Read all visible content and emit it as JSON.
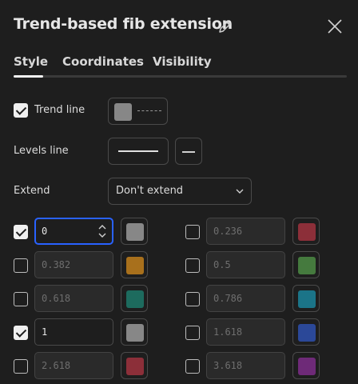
{
  "dialog": {
    "title": "Trend-based fib extension"
  },
  "tabs": [
    {
      "label": "Style",
      "active": true
    },
    {
      "label": "Coordinates",
      "active": false
    },
    {
      "label": "Visibility",
      "active": false
    }
  ],
  "style": {
    "trend_line": {
      "label": "Trend line",
      "checked": true,
      "color": "#878787"
    },
    "levels_line": {
      "label": "Levels line"
    },
    "extend": {
      "label": "Extend",
      "value": "Don't extend"
    }
  },
  "levels": [
    {
      "value": "0",
      "checked": true,
      "color": "#878787",
      "focused": true
    },
    {
      "value": "0.236",
      "checked": false,
      "color": "#8c2f39"
    },
    {
      "value": "0.382",
      "checked": false,
      "color": "#a8701c"
    },
    {
      "value": "0.5",
      "checked": false,
      "color": "#457a3e"
    },
    {
      "value": "0.618",
      "checked": false,
      "color": "#1d6b5e"
    },
    {
      "value": "0.786",
      "checked": false,
      "color": "#1b7488"
    },
    {
      "value": "1",
      "checked": true,
      "color": "#878787"
    },
    {
      "value": "1.618",
      "checked": false,
      "color": "#2b4898"
    },
    {
      "value": "2.618",
      "checked": false,
      "color": "#8c2f39"
    },
    {
      "value": "3.618",
      "checked": false,
      "color": "#6e2a78"
    }
  ]
}
